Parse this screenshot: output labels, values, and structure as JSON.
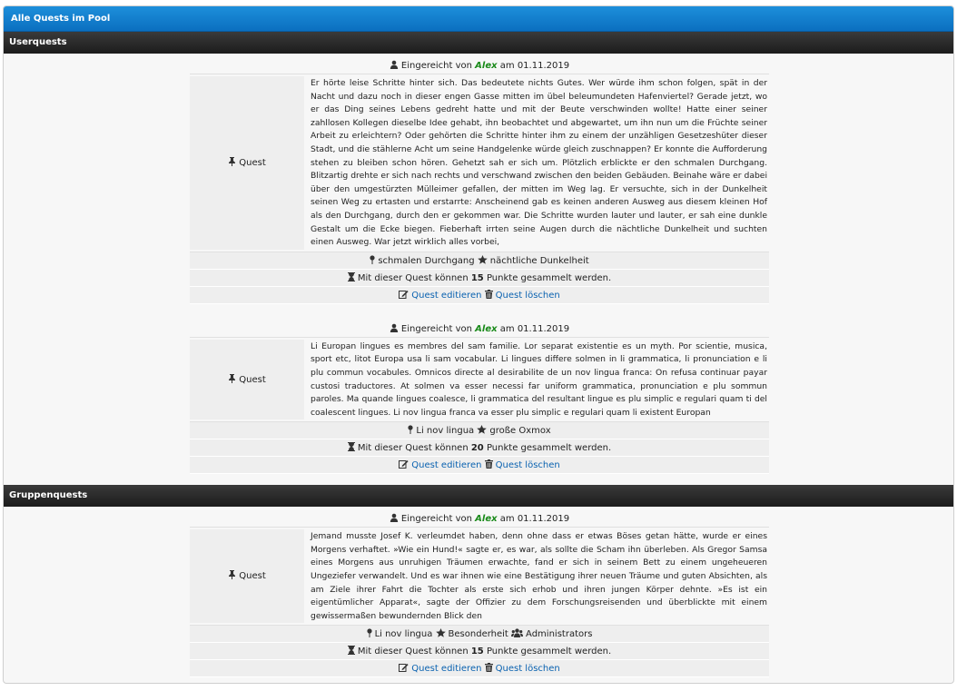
{
  "panel_title": "Alle Quests im Pool",
  "sections": [
    {
      "title": "Userquests",
      "quests": [
        {
          "submitted_prefix": "Eingereicht von",
          "user": "Alex",
          "date_text": "am 01.11.2019",
          "label": "Quest",
          "text": "Er hörte leise Schritte hinter sich. Das bedeutete nichts Gutes. Wer würde ihm schon folgen, spät in der Nacht und dazu noch in dieser engen Gasse mitten im übel beleumundeten Hafenviertel? Gerade jetzt, wo er das Ding seines Lebens gedreht hatte und mit der Beute verschwinden wollte! Hatte einer seiner zahllosen Kollegen dieselbe Idee gehabt, ihn beobachtet und abgewartet, um ihn nun um die Früchte seiner Arbeit zu erleichtern? Oder gehörten die Schritte hinter ihm zu einem der unzähligen Gesetzeshüter dieser Stadt, und die stählerne Acht um seine Handgelenke würde gleich zuschnappen? Er konnte die Aufforderung stehen zu bleiben schon hören. Gehetzt sah er sich um. Plötzlich erblickte er den schmalen Durchgang. Blitzartig drehte er sich nach rechts und verschwand zwischen den beiden Gebäuden. Beinahe wäre er dabei über den umgestürzten Mülleimer gefallen, der mitten im Weg lag. Er versuchte, sich in der Dunkelheit seinen Weg zu ertasten und erstarrte: Anscheinend gab es keinen anderen Ausweg aus diesem kleinen Hof als den Durchgang, durch den er gekommen war. Die Schritte wurden lauter und lauter, er sah eine dunkle Gestalt um die Ecke biegen. Fieberhaft irrten seine Augen durch die nächtliche Dunkelheit und suchten einen Ausweg. War jetzt wirklich alles vorbei,",
          "location": "schmalen Durchgang",
          "special": "nächtliche Dunkelheit",
          "group": "",
          "points_prefix": "Mit dieser Quest können",
          "points": "15",
          "points_suffix": "Punkte gesammelt werden.",
          "edit_label": "Quest editieren",
          "delete_label": "Quest löschen"
        },
        {
          "submitted_prefix": "Eingereicht von",
          "user": "Alex",
          "date_text": "am 01.11.2019",
          "label": "Quest",
          "text": "Li Europan lingues es membres del sam familie. Lor separat existentie es un myth. Por scientie, musica, sport etc, litot Europa usa li sam vocabular. Li lingues differe solmen in li grammatica, li pronunciation e li plu commun vocabules. Omnicos directe al desirabilite de un nov lingua franca: On refusa continuar payar custosi traductores. At solmen va esser necessi far uniform grammatica, pronunciation e plu sommun paroles. Ma quande lingues coalesce, li grammatica del resultant lingue es plu simplic e regulari quam ti del coalescent lingues. Li nov lingua franca va esser plu simplic e regulari quam li existent Europan",
          "location": "Li nov lingua",
          "special": "große Oxmox",
          "group": "",
          "points_prefix": "Mit dieser Quest können",
          "points": "20",
          "points_suffix": "Punkte gesammelt werden.",
          "edit_label": "Quest editieren",
          "delete_label": "Quest löschen"
        }
      ]
    },
    {
      "title": "Gruppenquests",
      "quests": [
        {
          "submitted_prefix": "Eingereicht von",
          "user": "Alex",
          "date_text": "am 01.11.2019",
          "label": "Quest",
          "text": "Jemand musste Josef K. verleumdet haben, denn ohne dass er etwas Böses getan hätte, wurde er eines Morgens verhaftet. »Wie ein Hund!« sagte er, es war, als sollte die Scham ihn überleben. Als Gregor Samsa eines Morgens aus unruhigen Träumen erwachte, fand er sich in seinem Bett zu einem ungeheueren Ungeziefer verwandelt. Und es war ihnen wie eine Bestätigung ihrer neuen Träume und guten Absichten, als am Ziele ihrer Fahrt die Tochter als erste sich erhob und ihren jungen Körper dehnte. »Es ist ein eigentümlicher Apparat«, sagte der Offizier zu dem Forschungsreisenden und überblickte mit einem gewissermaßen bewundernden Blick den",
          "location": "Li nov lingua",
          "special": "Besonderheit",
          "group": "Administrators",
          "points_prefix": "Mit dieser Quest können",
          "points": "15",
          "points_suffix": "Punkte gesammelt werden.",
          "edit_label": "Quest editieren",
          "delete_label": "Quest löschen"
        }
      ]
    }
  ]
}
